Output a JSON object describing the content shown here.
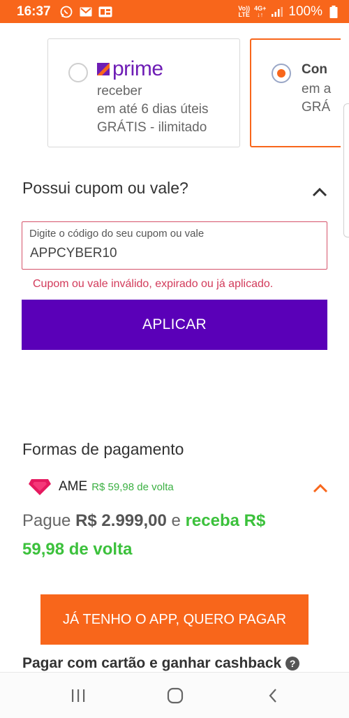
{
  "status_bar": {
    "time": "16:37",
    "net_top": "Vo))",
    "net_bottom": "LTE",
    "signal_top": "4G+",
    "battery": "100%"
  },
  "shipping": {
    "prime": {
      "logo_text": "prime",
      "line1": "receber",
      "line2": "em até 6 dias úteis",
      "line3": "GRÁTIS - ilimitado",
      "selected": false
    },
    "conventional": {
      "title": "Con",
      "line1": "em a",
      "line2": "GRÁ",
      "selected": true
    }
  },
  "coupon": {
    "title": "Possui cupom ou vale?",
    "field_label": "Digite o código do seu cupom ou vale",
    "field_value": "APPCYBER10",
    "error": "Cupom ou vale inválido, expirado ou já aplicado.",
    "apply_label": "APLICAR"
  },
  "payment": {
    "title": "Formas de pagamento",
    "ame_name": "AME",
    "ame_cashback": "R$ 59,98 de volta",
    "pay_word": "Pague",
    "pay_amount": "R$ 2.999,00",
    "pay_connector": "e",
    "receive_part1": "receba R$",
    "receive_part2": "59,98 de volta",
    "app_button": "JÁ TENHO O APP, QUERO PAGAR",
    "card_cashback": "Pagar com cartão e ganhar cashback",
    "help_glyph": "?"
  },
  "colors": {
    "brand_orange": "#f8661b",
    "purple": "#5a00b8",
    "error_red": "#d23a5a",
    "cashback_green": "#3cc13c"
  },
  "icons": [
    "whatsapp-icon",
    "gmail-icon",
    "app-notification-icon",
    "signal-icon",
    "battery-icon",
    "chevron-up-icon",
    "ame-heart-icon",
    "help-icon",
    "recents-icon",
    "home-icon",
    "back-icon"
  ]
}
